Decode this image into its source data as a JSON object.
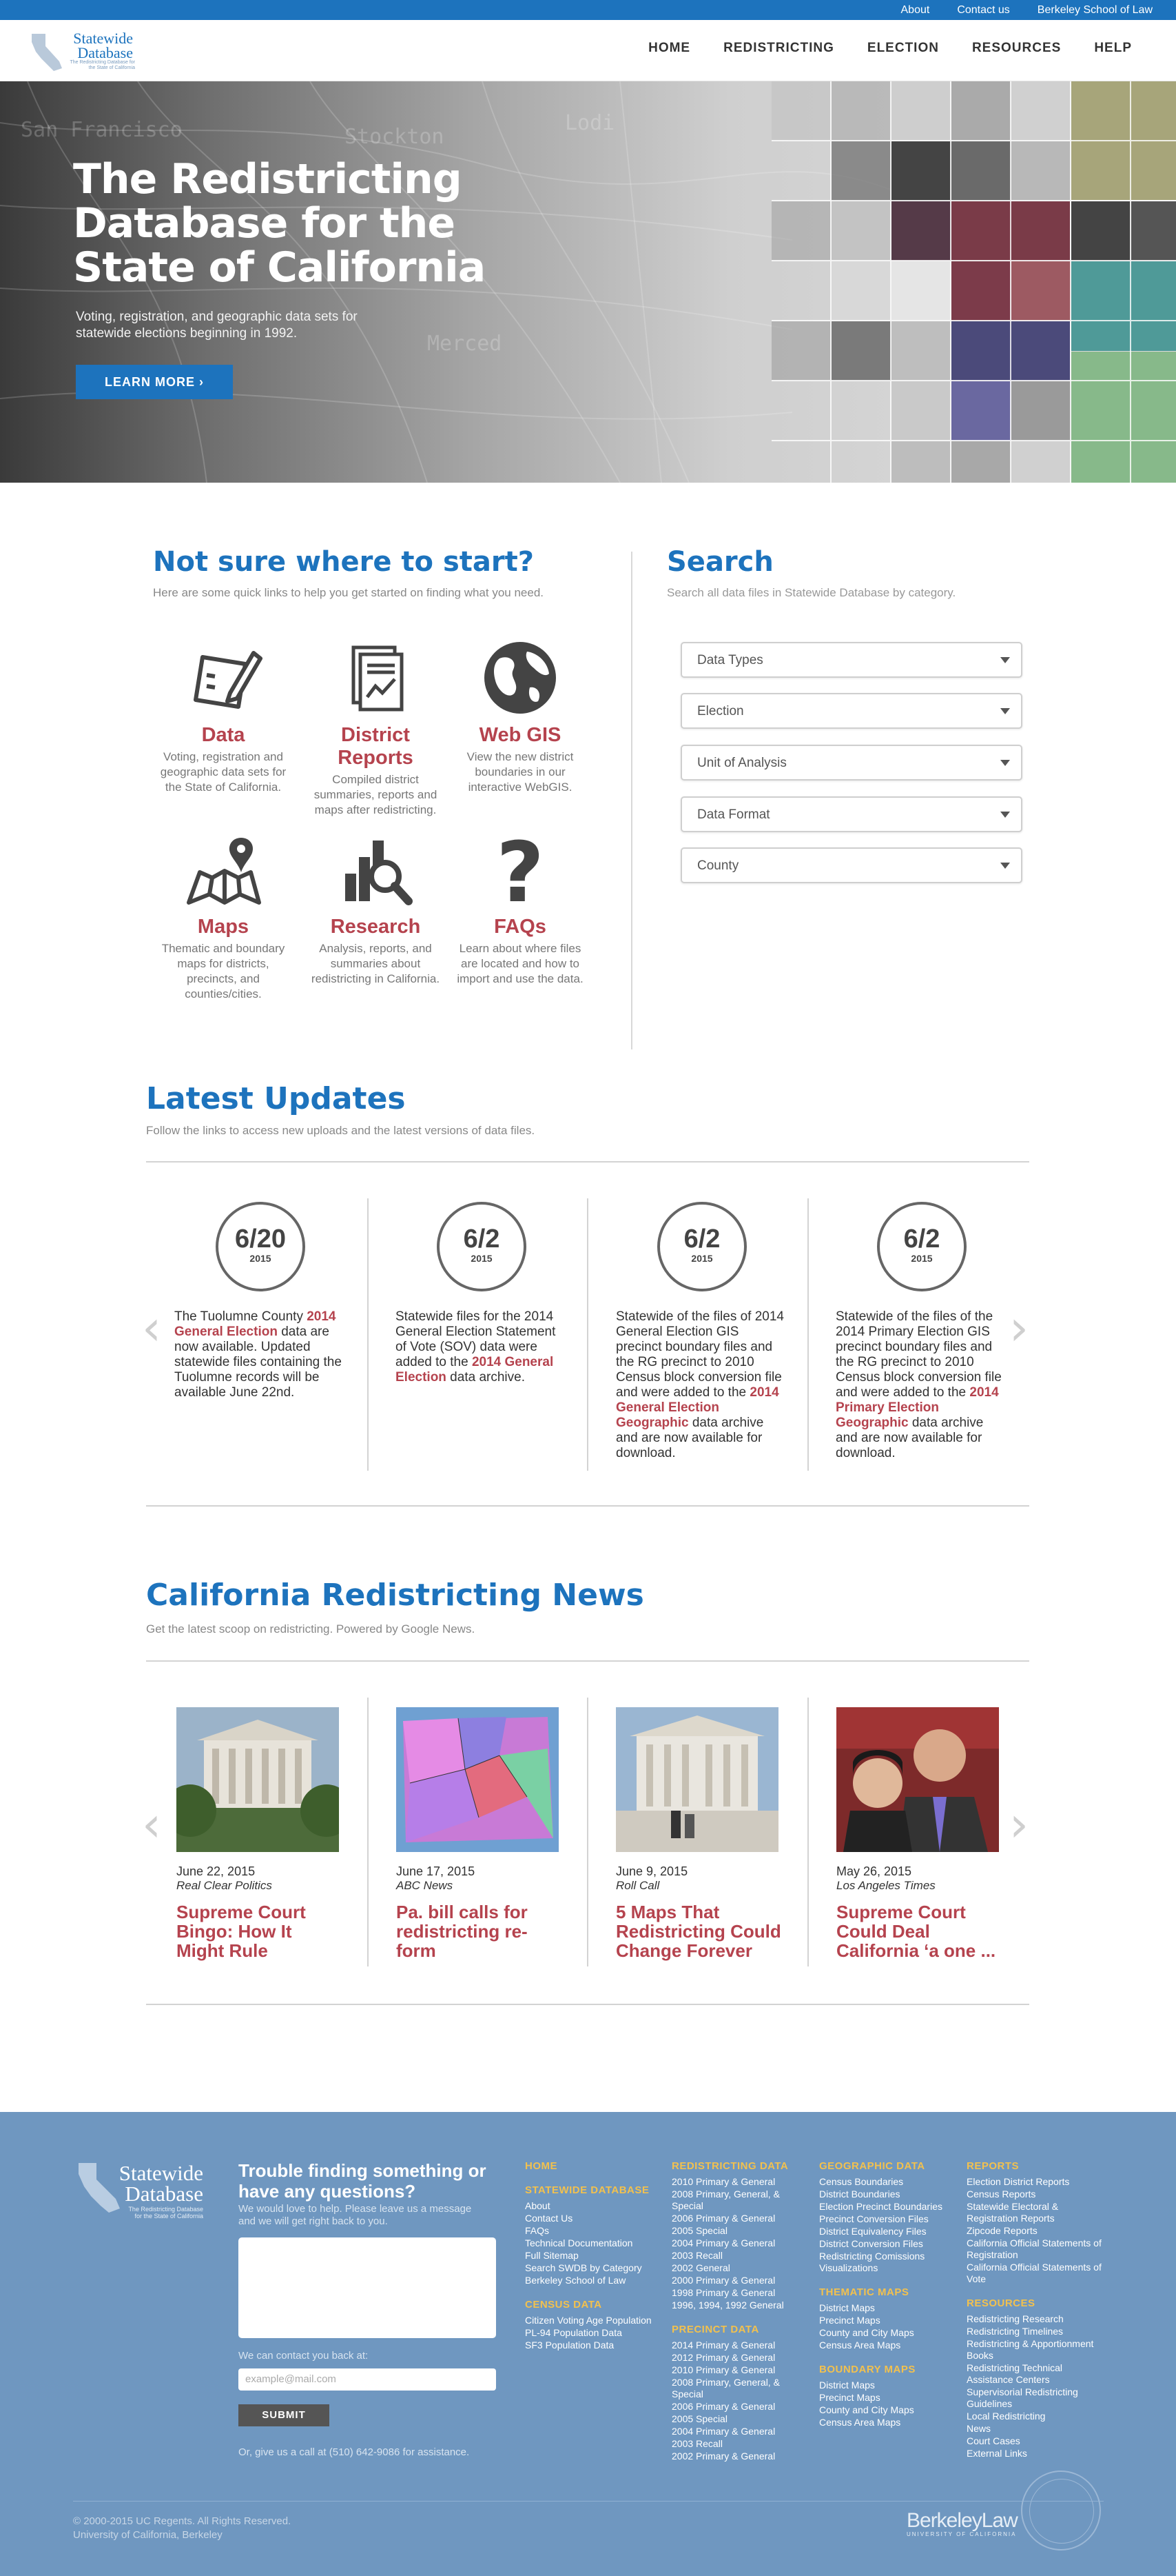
{
  "utility": {
    "links": [
      "About",
      "Contact us",
      "Berkeley School of Law"
    ]
  },
  "logo": {
    "line1": "Statewide",
    "line2": "Database",
    "tagline": "The Redistricting Database for the State of California"
  },
  "nav": [
    "HOME",
    "REDISTRICTING",
    "ELECTION",
    "RESOURCES",
    "HELP"
  ],
  "hero": {
    "title": "The Redistricting Database for the State of California",
    "subtitle": "Voting, registration, and geographic data sets for statewide elections beginning in 1992.",
    "button": "LEARN MORE  ›"
  },
  "start": {
    "title": "Not sure where to start?",
    "subtitle": "Here are some quick links to help you get started on finding what you need.",
    "items": [
      {
        "title": "Data",
        "desc": "Voting, registration and geographic data sets for the State of California.",
        "icon": "clipboard-pen-icon"
      },
      {
        "title": "District Reports",
        "desc": "Compiled district summaries, reports and maps after redistricting.",
        "icon": "document-chart-icon"
      },
      {
        "title": "Web GIS",
        "desc": "View the new district boundaries in our interactive WebGIS.",
        "icon": "globe-icon"
      },
      {
        "title": "Maps",
        "desc": "Thematic and boundary maps for districts, precincts, and counties/cities.",
        "icon": "map-pin-icon"
      },
      {
        "title": "Research",
        "desc": "Analysis, reports, and summaries about redistricting in California.",
        "icon": "bar-magnifier-icon"
      },
      {
        "title": "FAQs",
        "desc": "Learn about where files are located and how to import and use the data.",
        "icon": "question-mark-icon"
      }
    ]
  },
  "search": {
    "title": "Search",
    "subtitle": "Search all data files in Statewide Database by category.",
    "selects": [
      "Data Types",
      "Election",
      "Unit of Analysis",
      "Data Format",
      "County"
    ]
  },
  "updates": {
    "title": "Latest Updates",
    "subtitle": "Follow the links to access new uploads and the latest versions of data files.",
    "items": [
      {
        "date": "6/20",
        "year": "2015",
        "pre": "The Tuolumne County ",
        "link": "2014 General Election",
        "post": " data are now available. Updated statewide files containing the Tuolumne records will be available June 22nd."
      },
      {
        "date": "6/2",
        "year": "2015",
        "pre": "Statewide files for the 2014 General Election Statement of Vote (SOV) data were added to the ",
        "link": "2014 General Election",
        "post": " data archive."
      },
      {
        "date": "6/2",
        "year": "2015",
        "pre": "Statewide of the files of 2014 General Election GIS precinct boundary files and the RG precinct to 2010 Census block conversion file and were added to the ",
        "link": "2014 General Election Geographic",
        "post": " data archive and are now available for download."
      },
      {
        "date": "6/2",
        "year": "2015",
        "pre": "Statewide of the files of the 2014 Primary Election GIS precinct boundary files and the RG precinct to 2010 Census block conversion file and were added to the ",
        "link": "2014 Primary Election Geographic",
        "post": " data archive and are now available for download."
      }
    ]
  },
  "news": {
    "title": "California Redistricting News",
    "subtitle": "Get the latest scoop on redistricting. Powered by Google News.",
    "items": [
      {
        "date": "June 22, 2015",
        "source": "Real Clear Politics",
        "headline": "Supreme Court Bingo: How It Might Rule"
      },
      {
        "date": "June 17, 2015",
        "source": "ABC News",
        "headline": "Pa. bill calls for redistricting re-form"
      },
      {
        "date": "June 9, 2015",
        "source": "Roll Call",
        "headline": "5 Maps That Redistricting Could Change Forever"
      },
      {
        "date": "May 26, 2015",
        "source": "Los Angeles Times",
        "headline": "Supreme Court Could Deal California ‘a one ..."
      }
    ]
  },
  "footer": {
    "logo_line1": "Statewide",
    "logo_line2": "Database",
    "logo_tagline": "The Redistricting Database for the State of California",
    "question": "Trouble finding something or have any questions?",
    "question_sub": "We would love to help. Please leave us a message and we will get right back to you.",
    "contact_label": "We can contact you back at:",
    "email_placeholder": "example@mail.com",
    "submit": "SUBMIT",
    "call": "Or, give us a call at (510) 642-9086 for assistance.",
    "copyright1": "© 2000-2015 UC Regents. All Rights Reserved.",
    "copyright2": "University of California, Berkeley",
    "berkeley": "BerkeleyLaw",
    "berkeley_sub": "UNIVERSITY OF CALIFORNIA",
    "col1": [
      {
        "head": "HOME",
        "links": []
      },
      {
        "head": "STATEWIDE DATABASE",
        "links": [
          "About",
          "Contact Us",
          "FAQs",
          "Technical Documentation",
          "Full Sitemap",
          "Search SWDB by Category",
          "Berkeley School of Law"
        ]
      },
      {
        "head": "CENSUS DATA",
        "links": [
          "Citizen Voting Age Population",
          "PL-94 Population Data",
          "SF3 Population Data"
        ]
      }
    ],
    "col2": [
      {
        "head": "REDISTRICTING DATA",
        "links": [
          "2010 Primary & General",
          "2008 Primary, General, & Special",
          "2006 Primary & General",
          "2005 Special",
          "2004 Primary & General",
          "2003 Recall",
          "2002 General",
          "2000 Primary & General",
          "1998 Primary & General",
          "1996, 1994, 1992 General"
        ]
      },
      {
        "head": "PRECINCT DATA",
        "links": [
          "2014 Primary & General",
          "2012 Primary & General",
          "2010 Primary & General",
          "2008 Primary, General, & Special",
          "2006 Primary & General",
          "2005 Special",
          "2004 Primary & General",
          "2003 Recall",
          "2002 Primary & General"
        ]
      }
    ],
    "col3": [
      {
        "head": "GEOGRAPHIC DATA",
        "links": [
          "Census Boundaries",
          "District Boundaries",
          "Election Precinct Boundaries",
          "Precinct Conversion Files",
          "District Equivalency Files",
          "District Conversion Files",
          "Redistricting Comissions Visualizations"
        ]
      },
      {
        "head": "THEMATIC MAPS",
        "links": [
          "District Maps",
          "Precinct Maps",
          "County and City Maps",
          "Census Area Maps"
        ]
      },
      {
        "head": "BOUNDARY  MAPS",
        "links": [
          "District Maps",
          "Precinct Maps",
          "County and City Maps",
          "Census Area Maps"
        ]
      }
    ],
    "col4": [
      {
        "head": "REPORTS",
        "links": [
          "Election District Reports",
          "Census Reports",
          "Statewide Electoral & Registration Reports",
          "Zipcode Reports",
          "California Official Statements of Registration",
          "California Official Statements of Vote"
        ]
      },
      {
        "head": "RESOURCES",
        "links": [
          "Redistricting Research",
          "Redistricting Timelines",
          "Redistricting & Apportionment Books",
          "Redistricting Technical Assistance Centers",
          "Supervisorial Redistricting Guidelines",
          "Local Redistricting",
          "News",
          "Court Cases",
          "External Links"
        ]
      }
    ]
  },
  "colors": {
    "brand_blue": "#1d73bd",
    "accent_red": "#b5434e",
    "footer_blue": "#6f97c0",
    "footer_heading": "#f2c14e"
  }
}
